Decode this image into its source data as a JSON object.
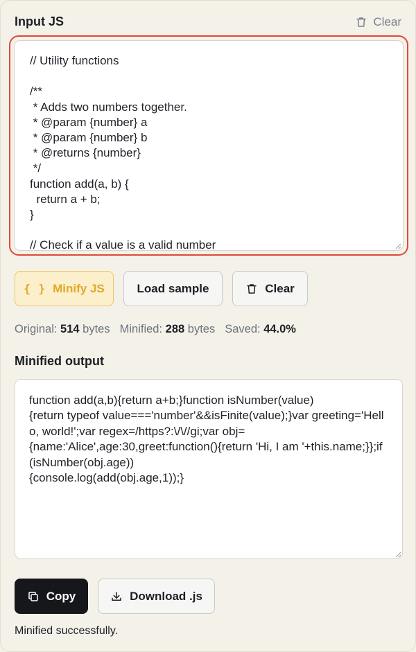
{
  "input": {
    "title": "Input JS",
    "clear_label": "Clear",
    "code": "// Utility functions\n\n/**\n * Adds two numbers together.\n * @param {number} a\n * @param {number} b\n * @returns {number}\n */\nfunction add(a, b) {\n  return a + b;\n}\n\n// Check if a value is a valid number"
  },
  "actions": {
    "minify_icon": "{ }",
    "minify_label": "Minify JS",
    "sample_label": "Load sample",
    "clear_label": "Clear"
  },
  "stats": {
    "original_label": "Original:",
    "original_value": "514",
    "original_unit": "bytes",
    "minified_label": "Minified:",
    "minified_value": "288",
    "minified_unit": "bytes",
    "saved_label": "Saved:",
    "saved_value": "44.0%"
  },
  "output": {
    "title": "Minified output",
    "code": "function add(a,b){return a+b;}function isNumber(value)\n{return typeof value==='number'&&isFinite(value);}var greeting='Hello, world!';var regex=/https?:\\/\\//gi;var obj=\n{name:'Alice',age:30,greet:function(){return 'Hi, I am '+this.name;}};if(isNumber(obj.age))\n{console.log(add(obj.age,1));}"
  },
  "output_actions": {
    "copy_label": "Copy",
    "download_label": "Download .js"
  },
  "status": "Minified successfully.",
  "colors": {
    "background": "#f4f1e9",
    "focus_ring": "#e0483a",
    "accent": "#e0a92b",
    "primary_dark": "#15171b"
  }
}
